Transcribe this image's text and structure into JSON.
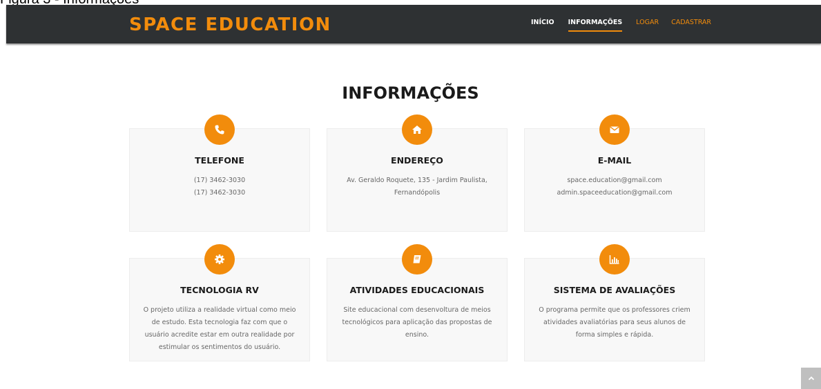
{
  "caption": "Figura 3 - Informações",
  "brand": "SPACE EDUCATION",
  "nav": {
    "items": [
      "INÍCIO",
      "INFORMAÇÕES",
      "LOGAR",
      "CADASTRAR"
    ]
  },
  "section_title": "INFORMAÇÕES",
  "cards": [
    {
      "icon": "phone-icon",
      "title": "TELEFONE",
      "lines": [
        "(17) 3462-3030",
        "(17) 3462-3030"
      ]
    },
    {
      "icon": "home-icon",
      "title": "ENDEREÇO",
      "lines": [
        "Av. Geraldo Roquete, 135 - Jardim Paulista,",
        "Fernandópolis"
      ]
    },
    {
      "icon": "envelope-icon",
      "title": "E-MAIL",
      "lines": [
        "space.education@gmail.com",
        "admin.spaceeducation@gmail.com"
      ]
    },
    {
      "icon": "gear-icon",
      "title": "TECNOLOGIA RV",
      "lines": [
        "O projeto utiliza a realidade virtual como meio",
        "de estudo. Esta tecnologia faz com que o",
        "usuário acredite estar em outra realidade por",
        "estimular os sentimentos do usuário."
      ]
    },
    {
      "icon": "book-icon",
      "title": "ATIVIDADES EDUCACIONAIS",
      "lines": [
        "Site educacional com desenvoltura de meios",
        "tecnológicos para aplicação das propostas de",
        "ensino."
      ]
    },
    {
      "icon": "bar-chart-icon",
      "title": "SISTEMA DE AVALIAÇÕES",
      "lines": [
        "O programa permite que os professores criem",
        "atividades avaliatórias para seus alunos de",
        "forma simples e rápida."
      ]
    }
  ],
  "colors": {
    "accent": "#f28c0c",
    "navbar": "#2e3133",
    "card": "#f8f8f8"
  }
}
